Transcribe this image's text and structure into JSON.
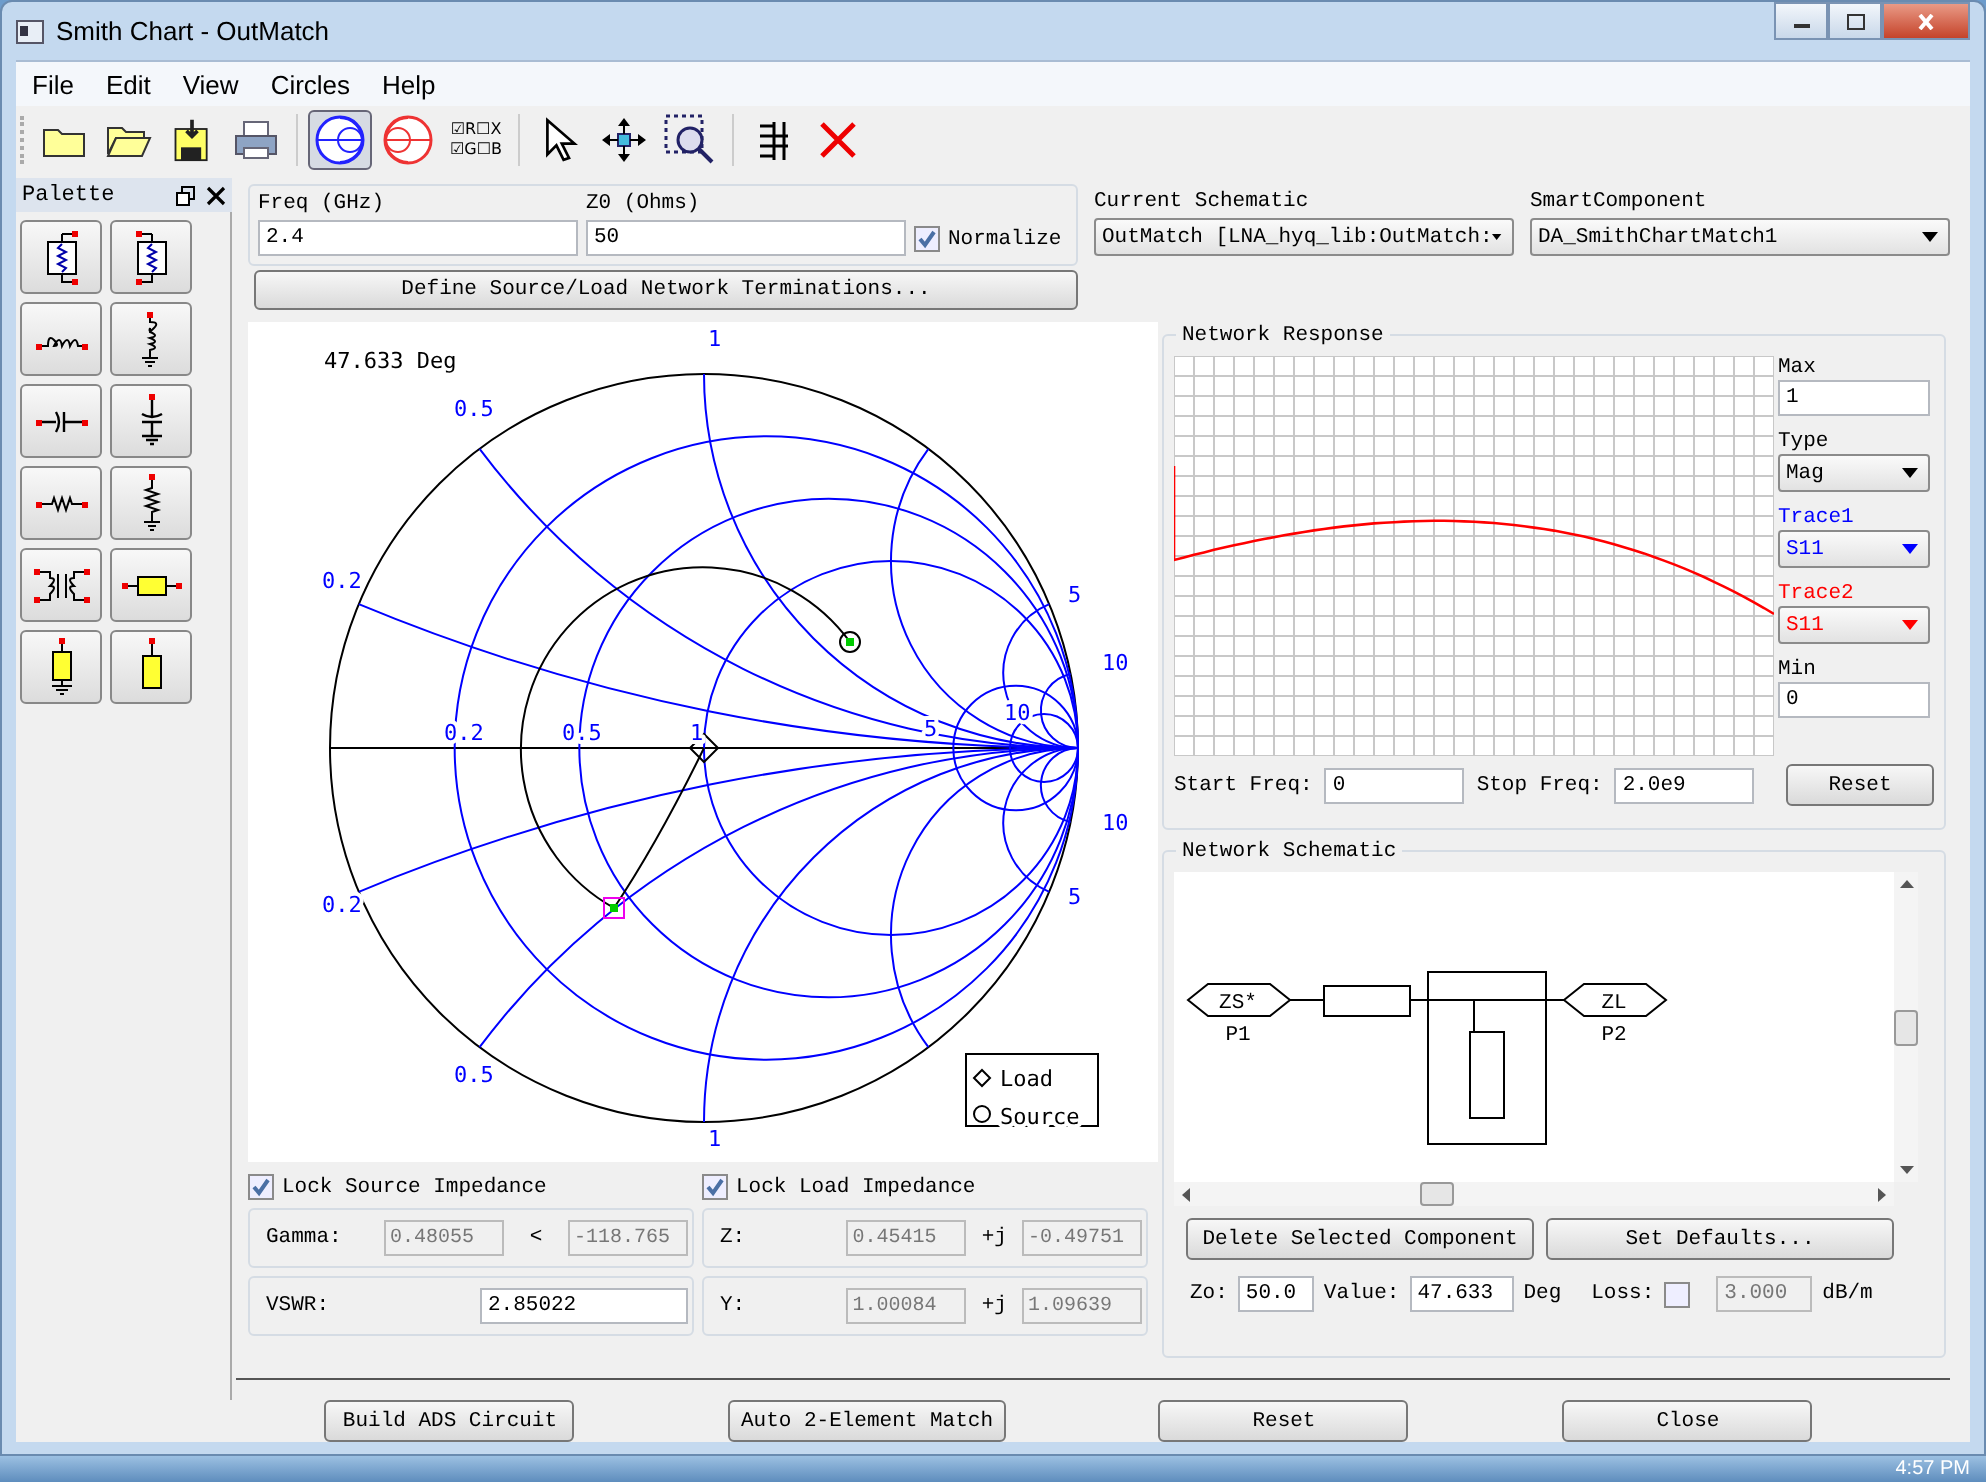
{
  "window": {
    "title": "Smith Chart - OutMatch"
  },
  "menu": [
    "File",
    "Edit",
    "View",
    "Circles",
    "Help"
  ],
  "toolbar": [
    {
      "kind": "new",
      "selected": false
    },
    {
      "kind": "open",
      "selected": false
    },
    {
      "kind": "save",
      "selected": false
    },
    {
      "kind": "print",
      "selected": false
    },
    {
      "kind": "z-chart",
      "selected": true
    },
    {
      "kind": "y-chart",
      "selected": false
    },
    {
      "kind": "labels",
      "selected": false,
      "lines": [
        "☑R☐X",
        "☑G☐B"
      ]
    },
    {
      "kind": "pointer",
      "selected": false
    },
    {
      "kind": "move",
      "selected": false
    },
    {
      "kind": "zoom",
      "selected": false
    },
    {
      "kind": "grid",
      "selected": false
    },
    {
      "kind": "delete",
      "selected": false
    }
  ],
  "palette": {
    "title": "Palette",
    "items": [
      {
        "kind": "parallel-left"
      },
      {
        "kind": "parallel-right"
      },
      {
        "kind": "series-inductor"
      },
      {
        "kind": "shunt-inductor"
      },
      {
        "kind": "series-capacitor"
      },
      {
        "kind": "shunt-capacitor"
      },
      {
        "kind": "series-resistor"
      },
      {
        "kind": "shunt-resistor"
      },
      {
        "kind": "transformer"
      },
      {
        "kind": "series-line"
      },
      {
        "kind": "shunt-stub-short"
      },
      {
        "kind": "shunt-stub-open"
      }
    ]
  },
  "params": {
    "freq": {
      "label": "Freq (GHz)",
      "value": "2.4"
    },
    "z0": {
      "label": "Z0 (Ohms)",
      "value": "50"
    },
    "normalize": {
      "label": "Normalize",
      "checked": true
    }
  },
  "current_schematic": {
    "label": "Current Schematic",
    "value": "OutMatch [LNA_hyq_lib:OutMatch:"
  },
  "smart_component": {
    "label": "SmartComponent",
    "value": "DA_SmithChartMatch1"
  },
  "define_button": "Define Source/Load Network Terminations...",
  "smith_chart": {
    "readout": "47.633 Deg",
    "labels": [
      "1",
      "0.5",
      "0.2",
      "0.2",
      "0.5",
      "1",
      "5",
      "10",
      "5",
      "10",
      "10",
      "5",
      "0.2",
      "0.5",
      "1"
    ],
    "legend": [
      {
        "kind": "diamond",
        "label": "Load"
      },
      {
        "kind": "circle",
        "label": "Source"
      }
    ]
  },
  "network_response": {
    "title": "Network Response",
    "max": {
      "label": "Max",
      "value": "1"
    },
    "type": {
      "label": "Type",
      "value": "Mag"
    },
    "traces": [
      {
        "label": "Trace1",
        "value": "S11",
        "color": "#0000ff"
      },
      {
        "label": "Trace2",
        "value": "S11",
        "color": "#ff0000"
      }
    ],
    "min": {
      "label": "Min",
      "value": "0"
    },
    "start_freq": {
      "label": "Start Freq:",
      "value": "0"
    },
    "stop_freq": {
      "label": "Stop Freq:",
      "value": "2.0e9"
    },
    "reset": "Reset"
  },
  "network_schematic": {
    "title": "Network Schematic",
    "ports": [
      {
        "symbol": "ZS*",
        "name": "P1"
      },
      {
        "symbol": "ZL",
        "name": "P2"
      }
    ],
    "buttons": [
      "Delete Selected Component",
      "Set Defaults..."
    ],
    "zo": {
      "label": "Zo:",
      "value": "50.0"
    },
    "value": {
      "label": "Value:",
      "value": "47.633",
      "unit": "Deg"
    },
    "loss": {
      "label": "Loss:",
      "checked": false,
      "value": "3.000",
      "unit": "dB/m",
      "disabled": true
    }
  },
  "source_impedance": {
    "lock": {
      "label": "Lock Source Impedance",
      "checked": true
    },
    "gamma": {
      "label": "Gamma:",
      "magnitude": "0.48055",
      "angle_symbol": "<",
      "angle": "-118.765",
      "disabled": true
    },
    "vswr": {
      "label": "VSWR:",
      "value": "2.85022",
      "disabled": false
    }
  },
  "load_impedance": {
    "lock": {
      "label": "Lock Load Impedance",
      "checked": true
    },
    "z": {
      "label": "Z:",
      "real": "0.45415",
      "operator": "+j",
      "imag": "-0.49751",
      "disabled": true
    },
    "y": {
      "label": "Y:",
      "real": "1.00084",
      "operator": "+j",
      "imag": "1.09639",
      "disabled": true
    }
  },
  "footer_buttons": [
    "Build ADS Circuit",
    "Auto 2-Element Match",
    "Reset",
    "Close"
  ],
  "taskbar": {
    "clock": "4:57 PM"
  }
}
